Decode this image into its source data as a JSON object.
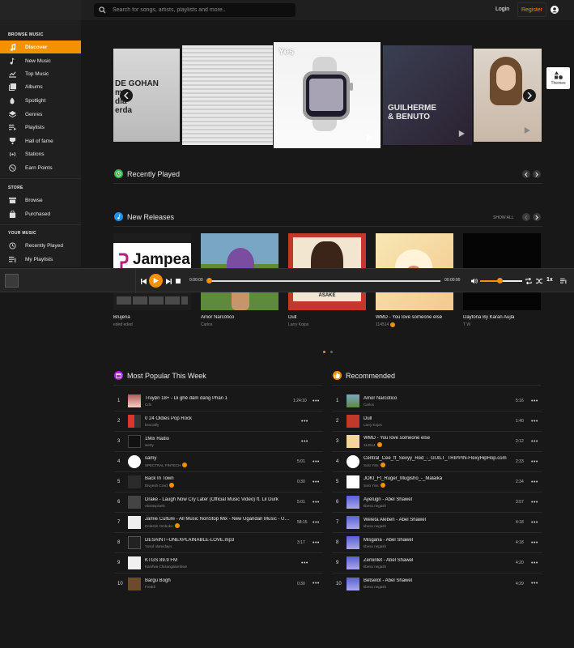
{
  "header": {
    "search_placeholder": "Search for songs, artists, playlists and more..",
    "login": "Login",
    "register": "Register"
  },
  "sidebar": {
    "browse_heading": "BROWSE MUSIC",
    "browse": [
      "Discover",
      "New Music",
      "Top Music",
      "Albums",
      "Spotlight",
      "Genres",
      "Playlists",
      "Hall of fame",
      "Stations",
      "Earn Points"
    ],
    "store_heading": "STORE",
    "store": [
      "Browse",
      "Purchased"
    ],
    "your_heading": "YOUR MUSIC",
    "your": [
      "Recently Played",
      "My Playlists"
    ]
  },
  "carousel": {
    "active_label": "Yes",
    "slide1_text": "DE GOHAN\nme\ndia\nerda",
    "slide4_text": "GUILHERME\n& BENUTO"
  },
  "themes": {
    "label": "Themes"
  },
  "sections": {
    "recently_played": "Recently Played",
    "new_releases": "New Releases",
    "show_all": "SHOW ALL",
    "most_popular": "Most Popular This Week",
    "recommended": "Recommended"
  },
  "releases": [
    {
      "title": "Brujeria",
      "artist": "eded eded",
      "badge": false,
      "cover_text": "Jampea"
    },
    {
      "title": "Amor Narcótico",
      "artist": "Carlos",
      "badge": false
    },
    {
      "title": "Dull",
      "artist": "Larry Kojos",
      "badge": false,
      "cover_text": "ASAKE"
    },
    {
      "title": "WMD - You love someone else",
      "artist": "114514",
      "badge": true
    },
    {
      "title": "Daytona By Karan Aujla",
      "artist": "T W",
      "badge": false
    }
  ],
  "player": {
    "current": "0:00:00",
    "total": "00:00:00",
    "speed": "1x"
  },
  "popular": [
    {
      "n": "1",
      "t": "Truyện 18+ - Di ghẻ dâm đãng Phần 1",
      "a": "Cdn",
      "badge": false,
      "d": "1:24:10"
    },
    {
      "n": "2",
      "t": "0 24 Oldies Pop Rock",
      "a": "bsocially",
      "badge": false,
      "d": ""
    },
    {
      "n": "3",
      "t": "1Mix Radio",
      "a": "werty",
      "badge": false,
      "d": ""
    },
    {
      "n": "4",
      "t": "samy",
      "a": "SPECTRAL FINTECH",
      "badge": true,
      "d": "5:01"
    },
    {
      "n": "5",
      "t": "Back In Town",
      "a": "Divyesh Czed",
      "badge": true,
      "d": "0:30"
    },
    {
      "n": "6",
      "t": "Drake - Laugh Now Cry Later (Official Music Video) ft. Lil Durk",
      "a": "Akwaspixels",
      "badge": false,
      "d": "5:01"
    },
    {
      "n": "7",
      "t": "Jamie Culture - All Music NonStop Mix - New Ugandan Music - Ugandan Music 2020 HD",
      "a": "Celestin Omboko",
      "badge": true,
      "d": "58:15"
    },
    {
      "n": "8",
      "t": "DESAINT~UNEXPLAINABLE-LOVE.mp3",
      "a": "Yusuf olamidayo",
      "badge": false,
      "d": "3:17"
    },
    {
      "n": "9",
      "t": "KTGS 89.9 FM",
      "a": "Kamfwa Chisangalumbwe",
      "badge": false,
      "d": ""
    },
    {
      "n": "10",
      "t": "Bargu Bogh",
      "a": "Freddi",
      "badge": false,
      "d": "0:30"
    }
  ],
  "recommended": [
    {
      "n": "1",
      "t": "Amor Narcótico",
      "a": "Carlos",
      "badge": false,
      "d": "5:16"
    },
    {
      "n": "2",
      "t": "Dull",
      "a": "Larry Kojos",
      "badge": false,
      "d": "1:40"
    },
    {
      "n": "3",
      "t": "WMD - You love someone else",
      "a": "114514",
      "badge": true,
      "d": "2:12"
    },
    {
      "n": "4",
      "t": "Central_Cee_ft_Sexyy_Red_-_GUILT_TRIPPIN-FlexyHipHop.com",
      "a": "Solo Yiss",
      "badge": true,
      "d": "2:33"
    },
    {
      "n": "5",
      "t": "JOKI_Ft_Ruger_Mugisho_-_Malaika",
      "a": "Solo Yiss",
      "badge": true,
      "d": "2:34"
    },
    {
      "n": "6",
      "t": "Ayelugn - Abel Shawel",
      "a": "tibeso negash",
      "badge": false,
      "d": "3:57"
    },
    {
      "n": "7",
      "t": "Weleta Aleben - Abel Shawel",
      "a": "tibeso negash",
      "badge": false,
      "d": "4:18"
    },
    {
      "n": "8",
      "t": "Misgana - Abel Shawel",
      "a": "tibeso negash",
      "badge": false,
      "d": "4:18"
    },
    {
      "n": "9",
      "t": "Zemirilet - Abel Shawel",
      "a": "tibeso negash",
      "badge": false,
      "d": "4:20"
    },
    {
      "n": "10",
      "t": "Betselot - Abel Shawel",
      "a": "tibeso negash",
      "badge": false,
      "d": "4:29"
    }
  ],
  "colors": {
    "accent": "#f39100",
    "bg": "#181818",
    "sidebar": "#1f1f1f"
  }
}
